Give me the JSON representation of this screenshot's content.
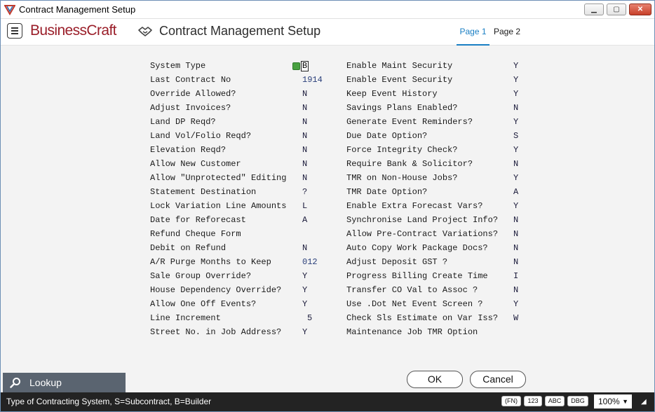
{
  "window": {
    "title": "Contract Management Setup",
    "minimize_label": "▁",
    "maximize_label": "▢",
    "close_label": "✕"
  },
  "header": {
    "logo_text": "BusinessCraft",
    "title": "Contract Management Setup",
    "tabs": [
      {
        "label": "Page 1",
        "active": true
      },
      {
        "label": "Page 2",
        "active": false
      }
    ]
  },
  "left_fields": [
    {
      "label": "System Type",
      "value": "B"
    },
    {
      "label": "Last Contract No",
      "value": "1914"
    },
    {
      "label": "Override Allowed?",
      "value": "N"
    },
    {
      "label": "Adjust Invoices?",
      "value": "N"
    },
    {
      "label": "Land DP Reqd?",
      "value": "N"
    },
    {
      "label": "Land Vol/Folio Reqd?",
      "value": "N"
    },
    {
      "label": "Elevation Reqd?",
      "value": "N"
    },
    {
      "label": "Allow New Customer",
      "value": "N"
    },
    {
      "label": "Allow \"Unprotected\" Editing",
      "value": "N"
    },
    {
      "label": "Statement Destination",
      "value": "?"
    },
    {
      "label": "Lock Variation Line Amounts",
      "value": "L"
    },
    {
      "label": "Date for Reforecast",
      "value": "A"
    },
    {
      "label": "Refund Cheque Form",
      "value": ""
    },
    {
      "label": "Debit on Refund",
      "value": "N"
    },
    {
      "label": "A/R Purge Months to Keep",
      "value": "012"
    },
    {
      "label": "Sale Group Override?",
      "value": "Y"
    },
    {
      "label": "House Dependency Override?",
      "value": "Y"
    },
    {
      "label": "Allow One Off Events?",
      "value": "Y"
    },
    {
      "label": "Line Increment",
      "value": "5"
    },
    {
      "label": "Street No. in Job Address?",
      "value": "Y"
    }
  ],
  "right_fields": [
    {
      "label": "Enable Maint Security",
      "value": "Y"
    },
    {
      "label": "Enable Event Security",
      "value": "Y"
    },
    {
      "label": "Keep Event History",
      "value": "Y"
    },
    {
      "label": "Savings Plans Enabled?",
      "value": "N"
    },
    {
      "label": "Generate Event Reminders?",
      "value": "Y"
    },
    {
      "label": "Due Date Option?",
      "value": "S"
    },
    {
      "label": "Force Integrity Check?",
      "value": "Y"
    },
    {
      "label": "Require Bank & Solicitor?",
      "value": "N"
    },
    {
      "label": "TMR on Non-House Jobs?",
      "value": "Y"
    },
    {
      "label": "TMR Date Option?",
      "value": "A"
    },
    {
      "label": "Enable Extra Forecast Vars?",
      "value": "Y"
    },
    {
      "label": "Synchronise Land Project Info?",
      "value": "N"
    },
    {
      "label": "Allow Pre-Contract Variations?",
      "value": "N"
    },
    {
      "label": "Auto Copy Work Package Docs?",
      "value": "N"
    },
    {
      "label": "Adjust Deposit GST ?",
      "value": "N"
    },
    {
      "label": "Progress Billing Create Time",
      "value": "I"
    },
    {
      "label": "Transfer CO Val to Assoc ?",
      "value": "N"
    },
    {
      "label": "Use .Dot Net Event Screen ?",
      "value": "Y"
    },
    {
      "label": "Check Sls Estimate on Var Iss?",
      "value": "W"
    },
    {
      "label": "Maintenance Job TMR Option",
      "value": ""
    }
  ],
  "buttons": {
    "ok": "OK",
    "cancel": "Cancel"
  },
  "lookup": {
    "label": "Lookup"
  },
  "statusbar": {
    "message": "Type of Contracting System, S=Subcontract, B=Builder",
    "chips": {
      "fn": "(FN)",
      "num": "123",
      "abc": "ABC",
      "dbg": "DBG"
    },
    "zoom": "100%"
  },
  "colors": {
    "brand": "#9a1e29",
    "tab_active": "#1a7fc4",
    "statusbar_bg": "#232323",
    "lookup_bg": "#5a6470",
    "system_type_icon": "#49a141"
  }
}
